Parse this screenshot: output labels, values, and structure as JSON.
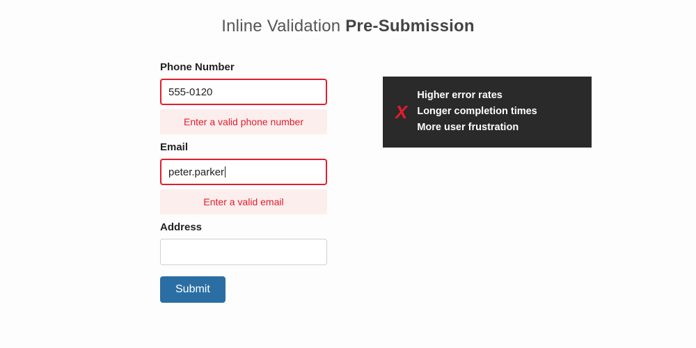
{
  "heading": {
    "light": "Inline Validation ",
    "bold": "Pre-Submission"
  },
  "form": {
    "phone": {
      "label": "Phone Number",
      "value": "555-0120",
      "error": "Enter a valid phone number"
    },
    "email": {
      "label": "Email",
      "value": "peter.parker",
      "error": "Enter a valid email"
    },
    "address": {
      "label": "Address",
      "value": ""
    },
    "submit": "Submit"
  },
  "callout": {
    "icon": "X",
    "items": [
      "Higher error rates",
      "Longer completion times",
      "More user frustration"
    ]
  }
}
